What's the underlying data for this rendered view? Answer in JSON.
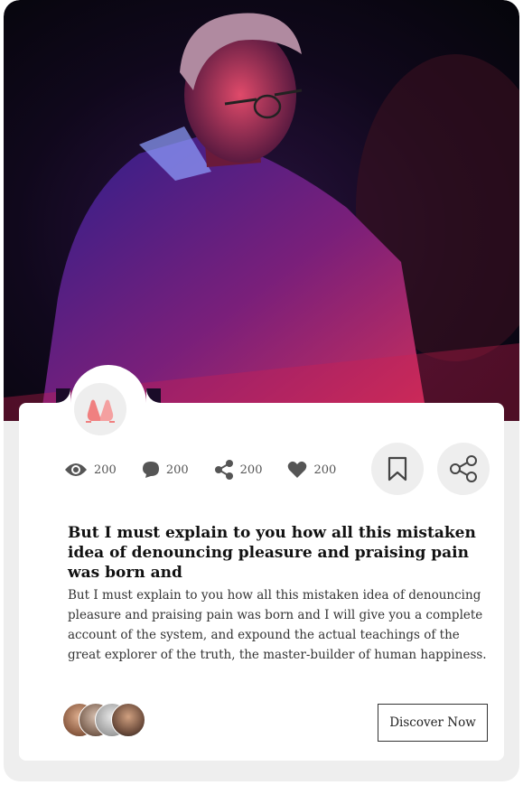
{
  "card": {
    "stats": [
      {
        "icon": "eye-icon",
        "count": "200"
      },
      {
        "icon": "comment-icon",
        "count": "200"
      },
      {
        "icon": "share-icon",
        "count": "200"
      },
      {
        "icon": "heart-icon",
        "count": "200"
      }
    ],
    "title": "But I must explain to you how all this mistaken idea of denouncing pleasure and praising pain was born and",
    "body": "But I must explain to you how all this mistaken idea of denouncing pleasure and praising pain was born and I will give you a complete account of the system, and expound the actual teachings of the great explorer of the truth, the master-builder of human happiness.",
    "cta_label": "Discover Now"
  },
  "colors": {
    "accent_icon": "#f08080",
    "icon_gray": "#555555",
    "button_bg": "#eeeeee"
  }
}
